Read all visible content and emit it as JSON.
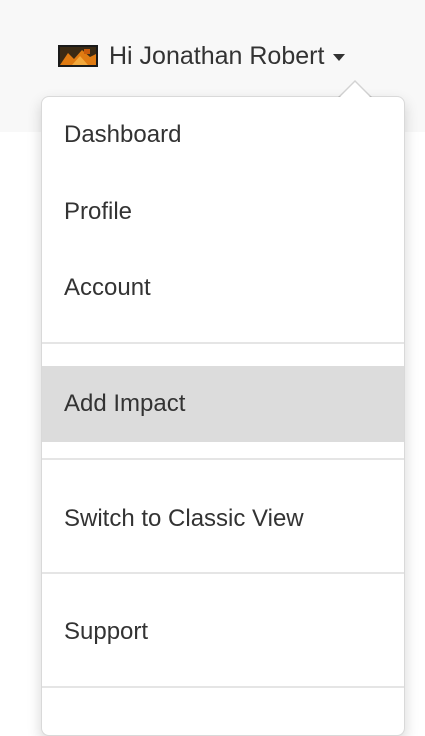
{
  "user_menu": {
    "greeting": "Hi Jonathan Robert",
    "avatar_icon": "user-avatar-thumbnail",
    "caret_icon": "caret-down-icon"
  },
  "dropdown": {
    "items": [
      {
        "label": "Dashboard"
      },
      {
        "label": "Profile"
      },
      {
        "label": "Account"
      },
      {
        "label": "Add Impact",
        "highlighted": true
      },
      {
        "label": "Switch to Classic View"
      },
      {
        "label": "Support"
      }
    ]
  },
  "colors": {
    "text": "#333333",
    "highlight": "#dcdcdc",
    "divider": "#e5e5e5",
    "topbar": "#f8f8f8"
  }
}
